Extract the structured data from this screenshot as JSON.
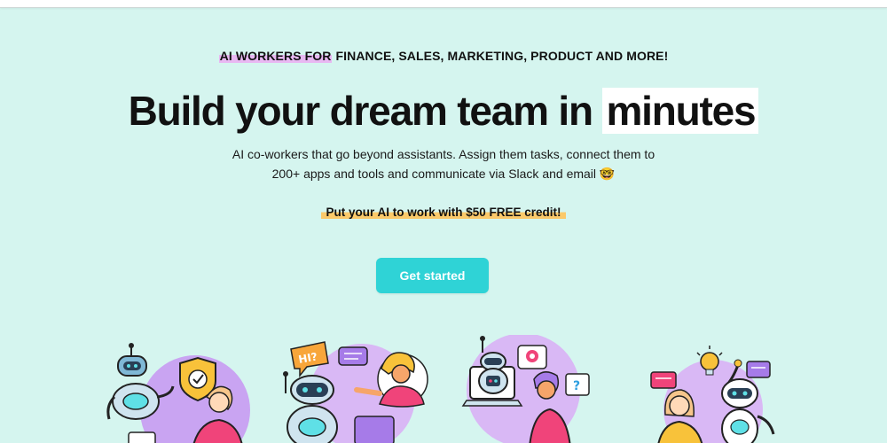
{
  "hero": {
    "eyebrow_highlight": "AI WORKERS FOR",
    "eyebrow_rest": " FINANCE, SALES, MARKETING, PRODUCT AND MORE!",
    "headline_main": "Build your dream team in ",
    "headline_boxed": "minutes",
    "subtext": "AI co-workers that go beyond assistants. Assign them tasks, connect them to 200+ apps and tools and communicate via Slack and email 🤓",
    "promo": "Put your AI to work with $50 FREE credit!",
    "cta_label": "Get started"
  },
  "illustrations": {
    "bubble_text": "HI?",
    "question_mark": "?"
  },
  "colors": {
    "background": "#d5f5ef",
    "cta": "#2fd3d6",
    "eyebrow_highlight": "#e8b8f2",
    "promo_highlight": "#fbc96a",
    "accent_purple": "#c9a4f2",
    "accent_pink": "#f0447a"
  }
}
